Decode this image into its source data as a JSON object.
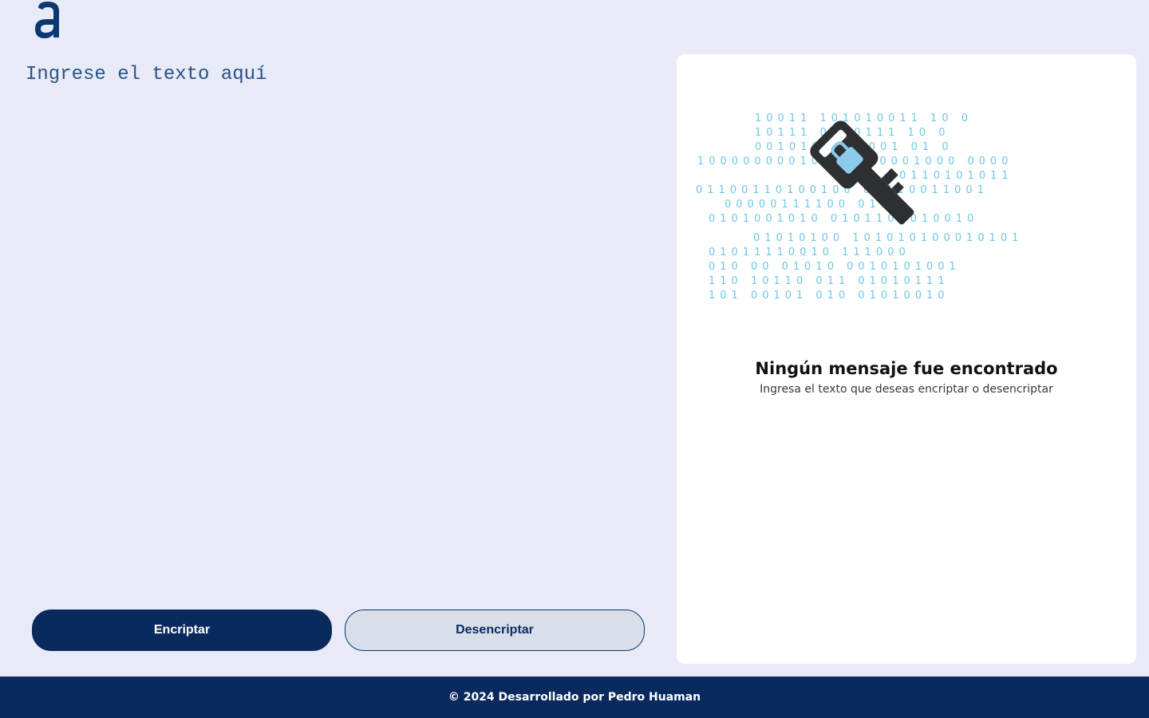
{
  "app": {
    "logo_icon": "alura-a-logo-icon",
    "logo_text": "a"
  },
  "input": {
    "placeholder": "Ingrese el texto aquí",
    "value": ""
  },
  "buttons": {
    "encrypt_label": "Encriptar",
    "decrypt_label": "Desencriptar"
  },
  "output_panel": {
    "illustration_icon": "key-with-lock-binary-icon",
    "title": "Ningún mensaje fue encontrado",
    "subtitle": "Ingresa el texto que deseas encriptar o desencriptar"
  },
  "footer": {
    "text": "© 2024 Desarrollado por Pedro Huaman"
  },
  "colors": {
    "background": "#e8ebf7",
    "primary": "#0a2a5e",
    "secondary_button": "#d8dfeb",
    "panel": "#ffffff",
    "binary": "#6ec6e8"
  }
}
